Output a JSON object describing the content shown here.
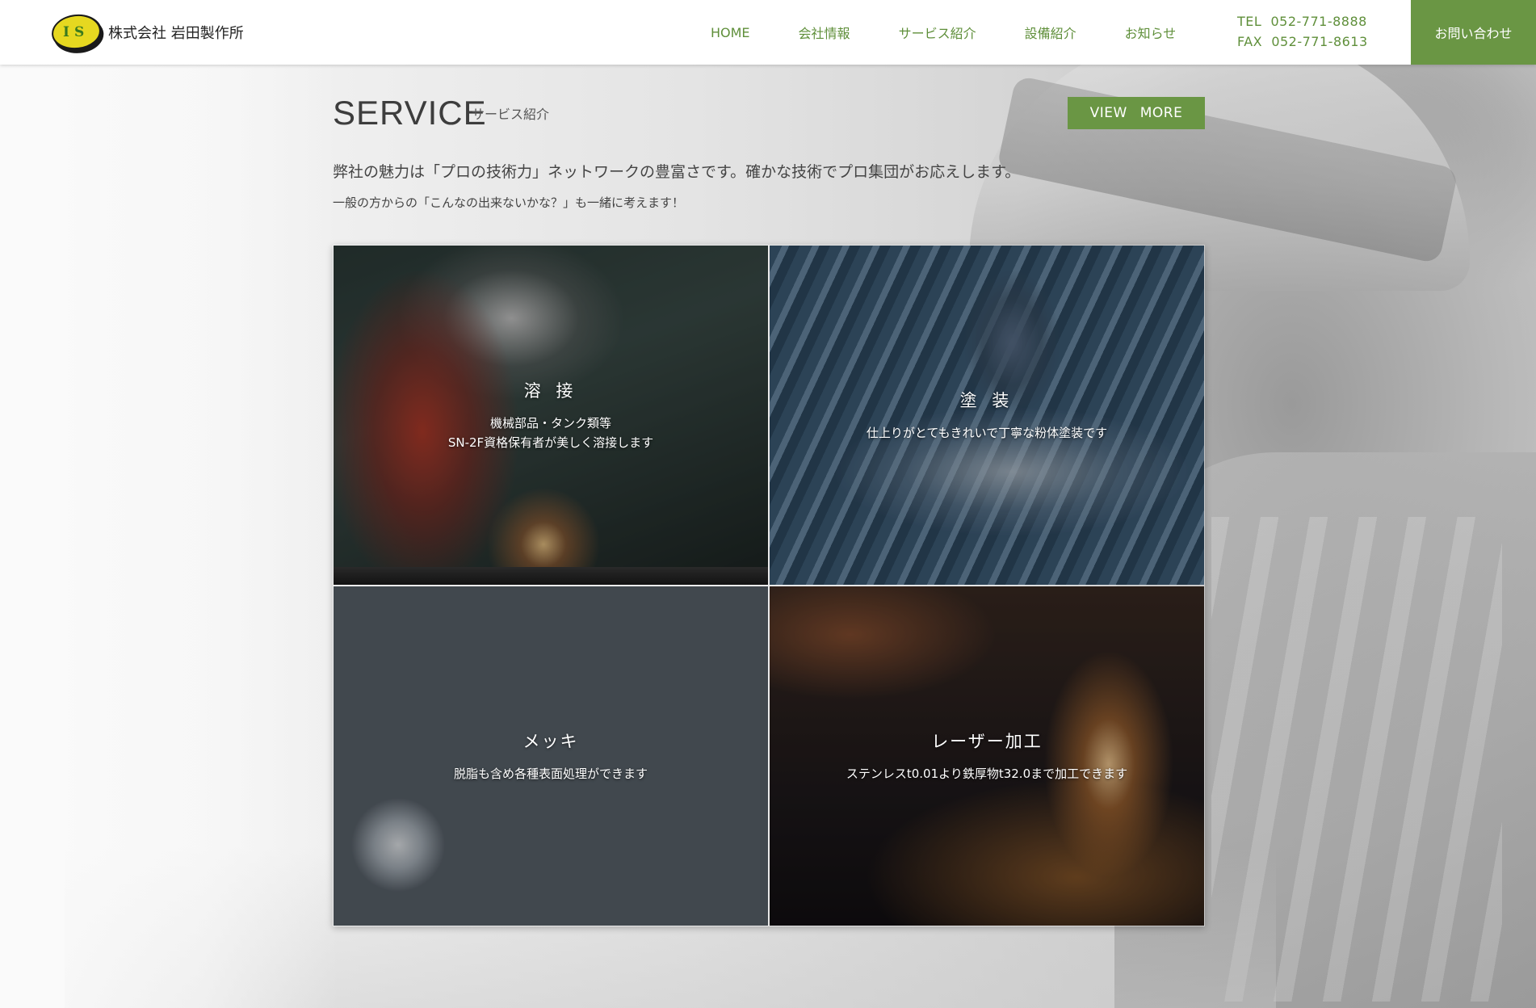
{
  "header": {
    "logo_initials": "IS",
    "company_name": "株式会社 岩田製作所",
    "nav": [
      {
        "label": "HOME"
      },
      {
        "label": "会社情報"
      },
      {
        "label": "サービス紹介"
      },
      {
        "label": "設備紹介"
      },
      {
        "label": "お知らせ"
      }
    ],
    "tel": "TEL  052-771-8888",
    "fax": "FAX  052-771-8613",
    "inquiry_label": "お問い合わせ"
  },
  "service": {
    "title": "SERVICE",
    "subtitle": "サービス紹介",
    "view_more": "VIEW MORE",
    "lead": "弊社の魅力は「プロの技術力」ネットワークの豊富さです。確かな技術でプロ集団がお応えします。",
    "sub_lead": "一般の方からの「こんなの出来ないかな？」も一緒に考えます！",
    "cards": [
      {
        "title": "溶 接",
        "desc_line1": "機械部品・タンク類等",
        "desc_line2": "SN-2F資格保有者が美しく溶接します"
      },
      {
        "title": "塗 装",
        "desc_line1": "仕上りがとてもきれいで丁寧な粉体塗装です",
        "desc_line2": ""
      },
      {
        "title": "メッキ",
        "desc_line1": "脱脂も含め各種表面処理ができます",
        "desc_line2": ""
      },
      {
        "title": "レーザー加工",
        "desc_line1": "ステンレスt0.01より鉄厚物t32.0まで加工できます",
        "desc_line2": ""
      }
    ]
  },
  "colors": {
    "accent_green": "#6a9644",
    "nav_text_green": "#5f8f3a",
    "logo_yellow": "#e6d820"
  }
}
